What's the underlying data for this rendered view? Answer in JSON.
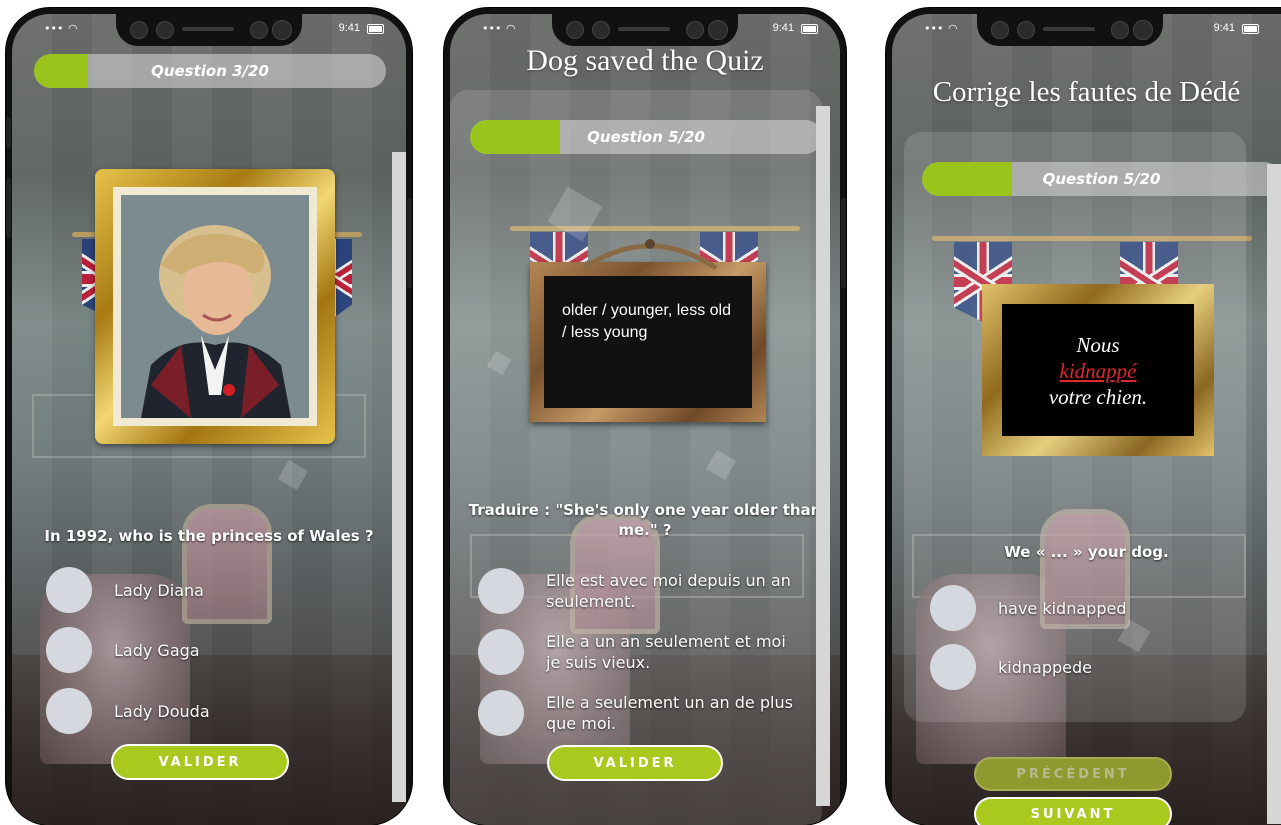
{
  "status": {
    "time": "9:41",
    "signal": "•••"
  },
  "screen1": {
    "progress": {
      "label": "Question 3/20",
      "fraction": 0.15
    },
    "question": "In 1992, who is the princess of Wales ?",
    "options": [
      "Lady Diana",
      "Lady Gaga",
      "Lady Douda"
    ],
    "button": "VALIDER"
  },
  "screen2": {
    "title": "Dog saved the Quiz",
    "progress": {
      "label": "Question 5/20",
      "fraction": 0.25
    },
    "board_text": "older / younger, less old / less young",
    "question": "Traduire : \"She's only one year older than me.\" ?",
    "options": [
      "Elle est avec moi depuis un an seulement.",
      "Elle a un an seulement et moi je suis vieux.",
      "Elle a seulement un an de plus que moi."
    ],
    "button": "VALIDER"
  },
  "screen3": {
    "title": "Corrige les fautes de Dédé",
    "progress": {
      "label": "Question 5/20",
      "fraction": 0.25
    },
    "frame_line1": "Nous",
    "frame_line2": "kidnappé",
    "frame_line3": "votre chien.",
    "question": "We « ... » your dog.",
    "options": [
      "have kidnapped",
      "kidnappede"
    ],
    "button_prev": "PRÉCÉDENT",
    "button_next": "SUIVANT"
  },
  "colors": {
    "accent": "#a9c91e",
    "progress_fill": "#9ac41c",
    "error_red": "#e0262b"
  }
}
